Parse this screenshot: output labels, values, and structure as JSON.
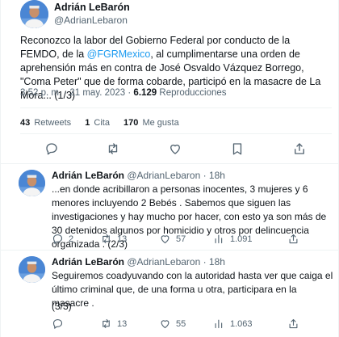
{
  "main_tweet": {
    "author_name": "Adrián LeBarón",
    "author_handle": "@AdrianLebaron",
    "text_before_link": "Reconozco la labor del Gobierno Federal por conducto de la FEMDO, de la ",
    "link": "@FGRMexico",
    "text_after_link": ", al cumplimentarse una orden de aprehensión más en contra de José Osvaldo Vázquez Borrego, \"Coma Peter\" que de forma cobarde, participó en la masacre de La Mora... (1/3)",
    "time": "3:52 p. m. · 21 may. 2023 · ",
    "views_count": "6.129",
    "views_label": " Reproducciones",
    "stats": {
      "retweets_count": "43",
      "retweets_label": "Retweets",
      "quotes_count": "1",
      "quotes_label": "Cita",
      "likes_count": "170",
      "likes_label": "Me gusta"
    },
    "icons": [
      "reply-icon",
      "retweet-icon",
      "like-icon",
      "bookmark-icon",
      "share-icon"
    ]
  },
  "replies": [
    {
      "author_name": "Adrián LeBarón",
      "author_handle": "@AdrianLebaron · 18h",
      "text": "...en donde acribillaron a personas inocentes, 3 mujeres y 6 menores incluyendo 2 Bebés . Sabemos que siguen las investigaciones y hay mucho por hacer, con esto ya son más de 30 detenidos algunos por homicidio y otros por delincuencia organizada .  (2/3)",
      "replies": "2",
      "retweets": "13",
      "likes": "57",
      "views": "1.091"
    },
    {
      "author_name": "Adrián LeBarón",
      "author_handle": "@AdrianLebaron · 18h",
      "text": "Seguiremos coadyuvando con la autoridad hasta ver que caiga el último criminal que, de una forma u otra, participara en la masacre .",
      "text_end": "(3/3)",
      "replies": "",
      "retweets": "13",
      "likes": "55",
      "views": "1.063"
    }
  ],
  "colors": {
    "link": "#1d9bf0",
    "muted": "#536471",
    "text": "#0f1419",
    "divider": "#eff3f4"
  }
}
